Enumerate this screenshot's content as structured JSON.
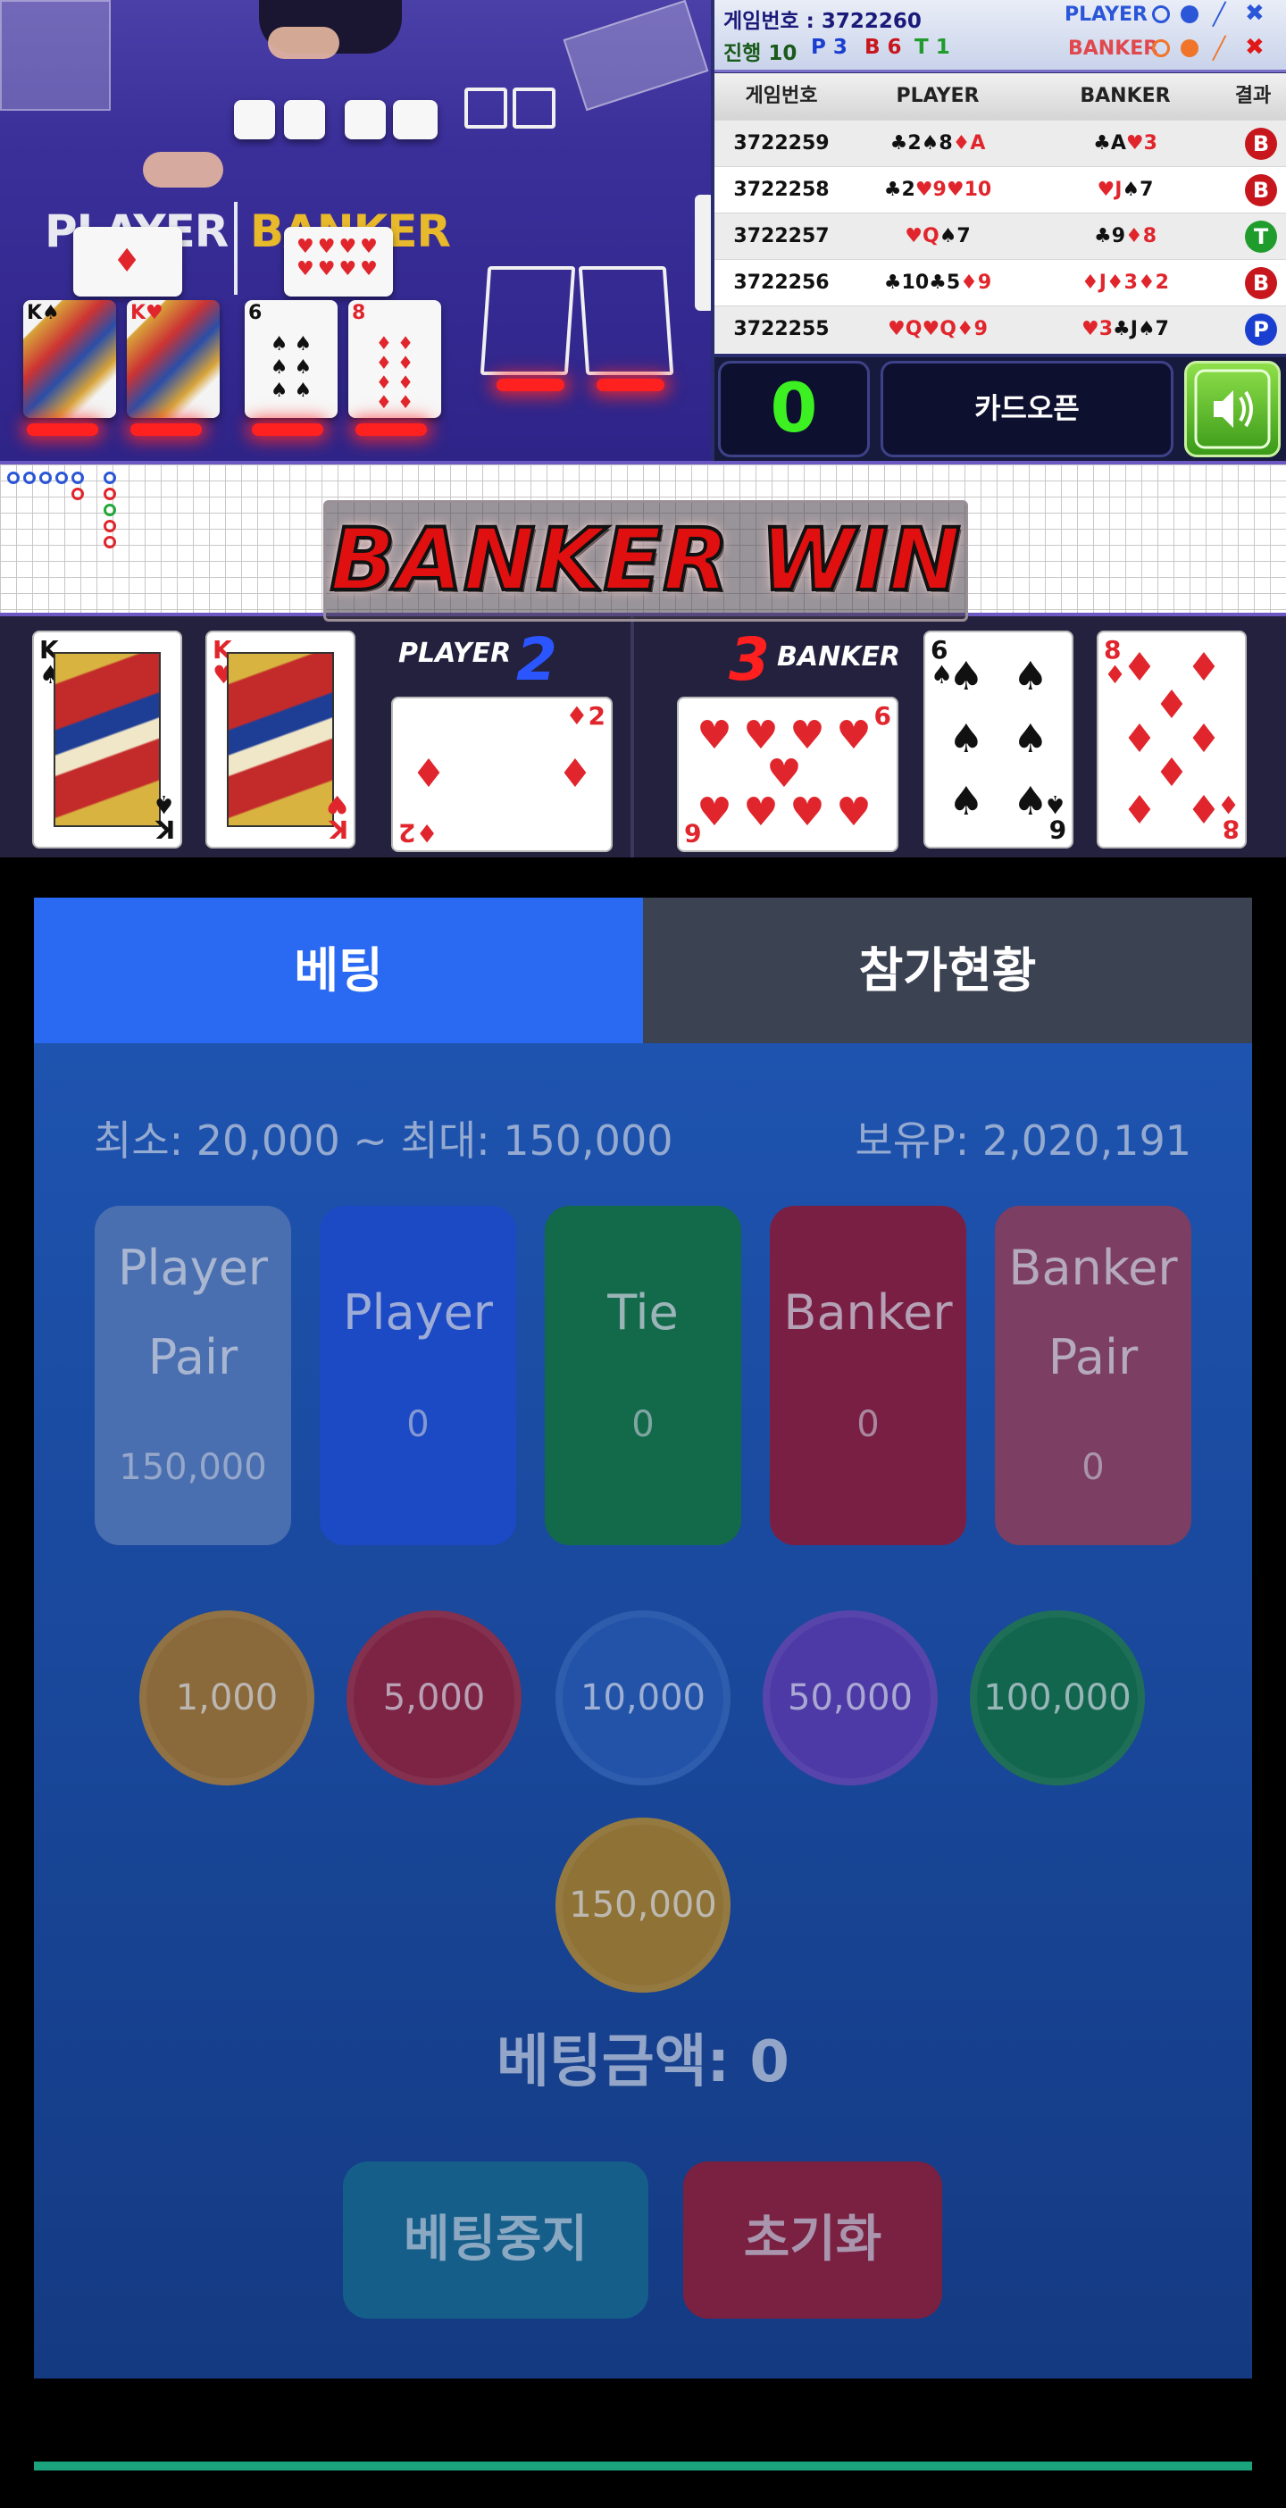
{
  "info": {
    "game_no_label": "게임번호 : 3722260",
    "progress_label": "진행 10",
    "p_count": "P 3",
    "b_count": "B 6",
    "t_count": "T 1",
    "player_tag": "PLAYER",
    "banker_tag": "BANKER"
  },
  "felt": {
    "player": "PLAYER",
    "banker": "BANKER"
  },
  "history": {
    "headers": [
      "게임번호",
      "PLAYER",
      "BANKER",
      "결과"
    ],
    "rows": [
      {
        "no": "3722259",
        "player": [
          [
            "♣",
            "2",
            "b"
          ],
          [
            "♠",
            "8",
            "b"
          ],
          [
            "♦",
            "A",
            "r"
          ]
        ],
        "banker": [
          [
            "♣",
            "A",
            "b"
          ],
          [
            "♥",
            "3",
            "r"
          ]
        ],
        "result": "B",
        "result_color": "#c8161d"
      },
      {
        "no": "3722258",
        "player": [
          [
            "♣",
            "2",
            "b"
          ],
          [
            "♥",
            "9",
            "r"
          ],
          [
            "♥",
            "10",
            "r"
          ]
        ],
        "banker": [
          [
            "♥",
            "J",
            "r"
          ],
          [
            "♠",
            "7",
            "b"
          ]
        ],
        "result": "B",
        "result_color": "#c8161d"
      },
      {
        "no": "3722257",
        "player": [
          [
            "♥",
            "Q",
            "r"
          ],
          [
            "♠",
            "7",
            "b"
          ]
        ],
        "banker": [
          [
            "♣",
            "9",
            "b"
          ],
          [
            "♦",
            "8",
            "r"
          ]
        ],
        "result": "T",
        "result_color": "#1f9c2c"
      },
      {
        "no": "3722256",
        "player": [
          [
            "♣",
            "10",
            "b"
          ],
          [
            "♣",
            "5",
            "b"
          ],
          [
            "♦",
            "9",
            "r"
          ]
        ],
        "banker": [
          [
            "♦",
            "J",
            "r"
          ],
          [
            "♦",
            "3",
            "r"
          ],
          [
            "♦",
            "2",
            "r"
          ]
        ],
        "result": "B",
        "result_color": "#c8161d"
      },
      {
        "no": "3722255",
        "player": [
          [
            "♥",
            "Q",
            "r"
          ],
          [
            "♥",
            "Q",
            "r"
          ],
          [
            "♦",
            "9",
            "r"
          ]
        ],
        "banker": [
          [
            "♥",
            "3",
            "r"
          ],
          [
            "♣",
            "J",
            "b"
          ],
          [
            "♠",
            "7",
            "b"
          ]
        ],
        "result": "P",
        "result_color": "#1a3ed0"
      }
    ]
  },
  "controls": {
    "countdown": "0",
    "card_open": "카드오픈"
  },
  "banner": {
    "text": "BANKER WIN"
  },
  "result_strip": {
    "player_label": "PLAYER",
    "player_score": "2",
    "banker_label": "BANKER",
    "banker_score": "3"
  },
  "tabs": {
    "bet": "베팅",
    "status": "참가현황"
  },
  "limits": {
    "text": "최소: 20,000 ~ 최대: 150,000"
  },
  "points": {
    "text": "보유P: 2,020,191"
  },
  "bets": [
    {
      "line1": "Player",
      "line2": "Pair",
      "amount": "150,000",
      "color": "#4a6fb0"
    },
    {
      "line1": "Player",
      "line2": "",
      "amount": "0",
      "color": "#1c49c4"
    },
    {
      "line1": "Tie",
      "line2": "",
      "amount": "0",
      "color": "#126a4a"
    },
    {
      "line1": "Banker",
      "line2": "",
      "amount": "0",
      "color": "#7a1f44"
    },
    {
      "line1": "Banker",
      "line2": "Pair",
      "amount": "0",
      "color": "#7c3e62"
    }
  ],
  "chips": [
    {
      "label": "1,000",
      "color": "#8a6a3a"
    },
    {
      "label": "5,000",
      "color": "#7d2444"
    },
    {
      "label": "10,000",
      "color": "#2353a8"
    },
    {
      "label": "50,000",
      "color": "#4d3aa6"
    },
    {
      "label": "100,000",
      "color": "#12664e"
    },
    {
      "label": "150,000",
      "color": "#8e7236"
    }
  ],
  "bet_total": {
    "text": "베팅금액: 0"
  },
  "actions": {
    "stop": "베팅중지",
    "reset": "초기화"
  }
}
